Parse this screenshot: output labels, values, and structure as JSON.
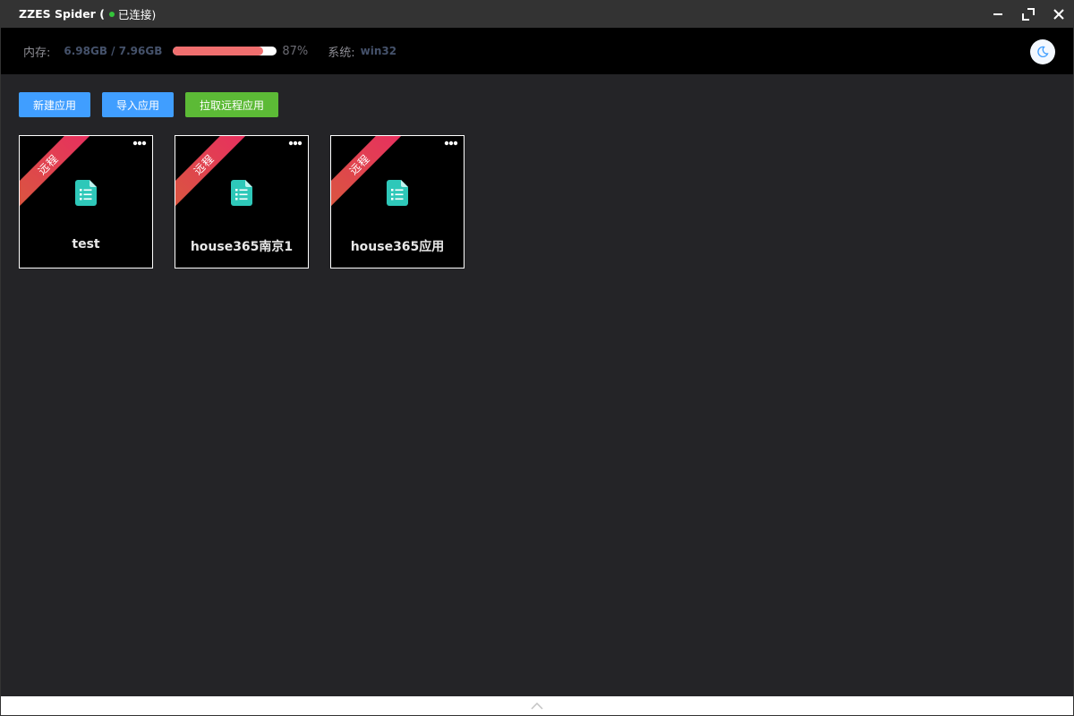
{
  "titlebar": {
    "title": "ZZES Spider (",
    "status": "已连接)",
    "status_color": "#34c43a",
    "controls": [
      "minimize-icon",
      "maximize-icon",
      "close-icon"
    ]
  },
  "infobar": {
    "memory_label": "内存:",
    "memory_value": "6.98GB / 7.96GB",
    "memory_fraction": 0.87,
    "memory_percent": "87%",
    "system_label": "系统:",
    "system_value": "win32",
    "theme_toggle_icon": "moon-icon"
  },
  "toolbar": {
    "new_app": "新建应用",
    "import_app": "导入应用",
    "pull_remote": "拉取远程应用"
  },
  "cards": [
    {
      "ribbon": "远程",
      "name": "test",
      "icon": "document-list-icon"
    },
    {
      "ribbon": "远程",
      "name": "house365南京1",
      "icon": "document-list-icon"
    },
    {
      "ribbon": "远程",
      "name": "house365应用",
      "icon": "document-list-icon"
    }
  ],
  "bottom": {
    "icon": "chevron-up-icon"
  },
  "colors": {
    "accent_blue": "#409eff",
    "accent_green": "#5cba36",
    "progress": "#f06f6f",
    "doc_icon": "#2ec8b9",
    "ribbon_start": "#d9573f",
    "ribbon_end": "#e82e60"
  }
}
